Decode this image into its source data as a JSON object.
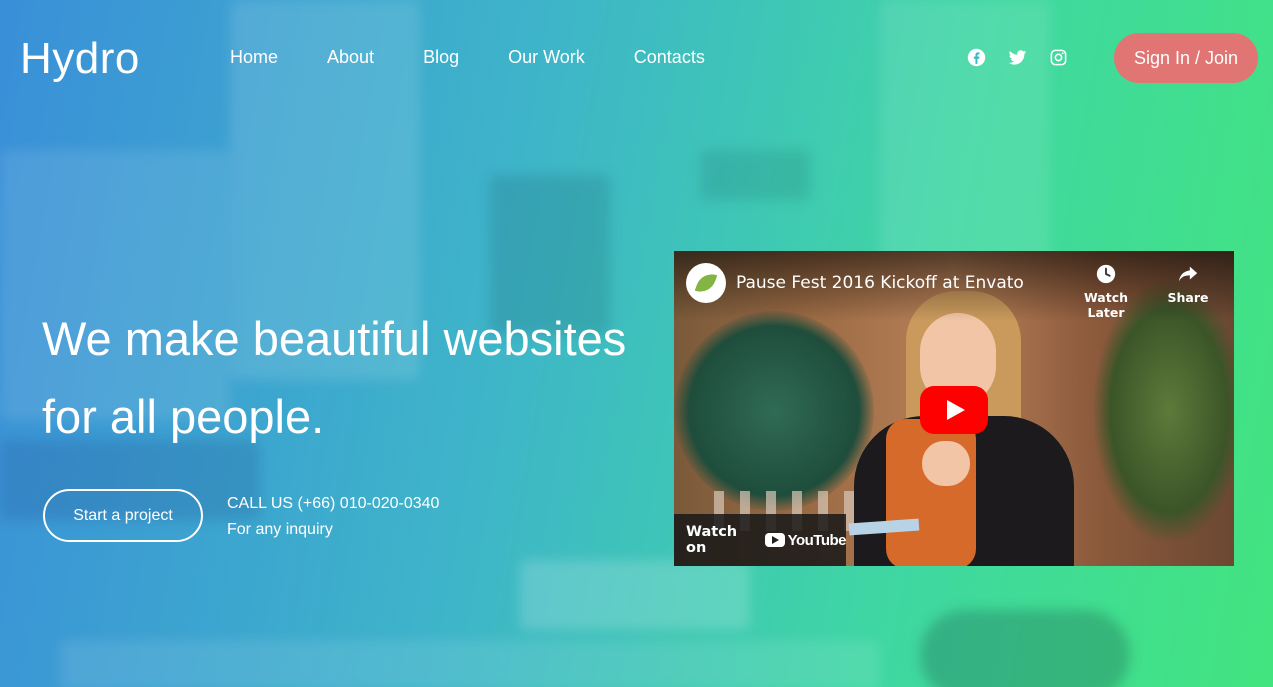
{
  "brand": {
    "logo": "Hydro"
  },
  "nav": {
    "items": [
      {
        "label": "Home"
      },
      {
        "label": "About"
      },
      {
        "label": "Blog"
      },
      {
        "label": "Our Work"
      },
      {
        "label": "Contacts"
      }
    ]
  },
  "social": {
    "icons": [
      "facebook-icon",
      "twitter-icon",
      "instagram-icon"
    ]
  },
  "header": {
    "signin_label": "Sign In / Join",
    "signin_color": "#e07573"
  },
  "hero": {
    "title_line1": "We make beautiful websites",
    "title_line2": "for all people.",
    "cta_label": "Start a project",
    "call_label": "CALL US (+66) 010-020-0340",
    "inquiry_label": "For any inquiry"
  },
  "video": {
    "title": "Pause Fest 2016 Kickoff at Envato",
    "watch_later_label": "Watch Later",
    "share_label": "Share",
    "watch_on_label": "Watch on",
    "youtube_label": "YouTube"
  },
  "colors": {
    "gradient_start": "#3a8fd8",
    "gradient_end": "#42e47f"
  }
}
